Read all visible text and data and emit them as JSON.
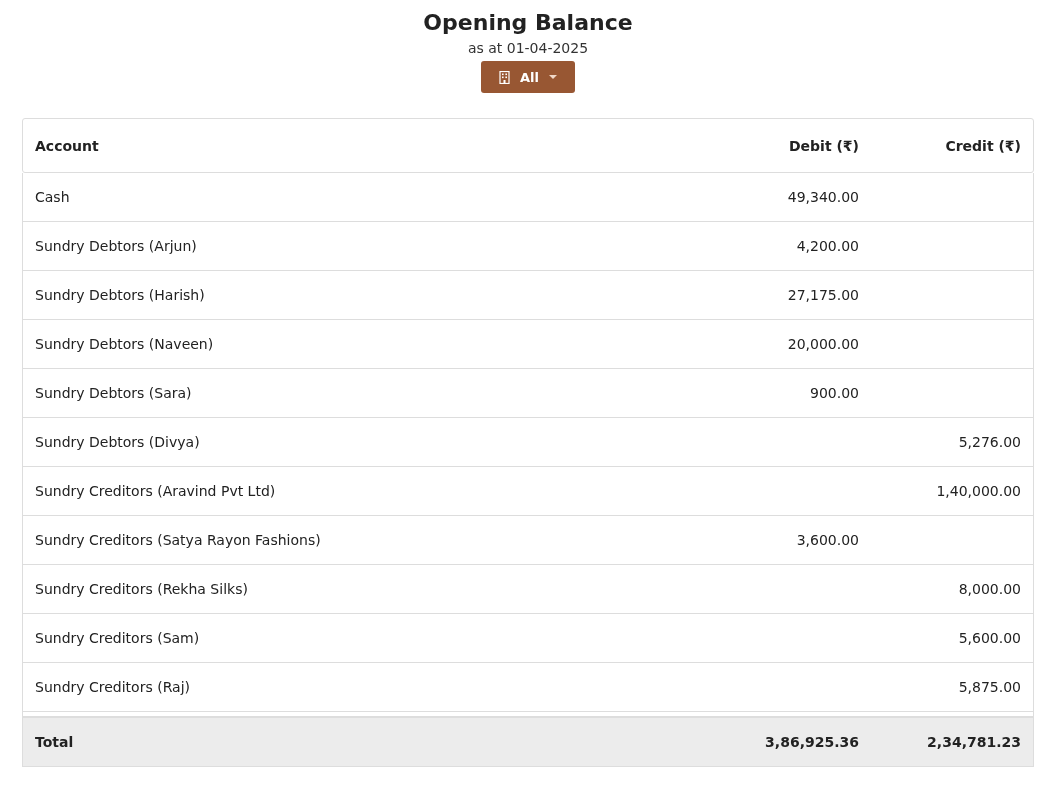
{
  "title": "Opening Balance",
  "subtitle": "as at 01-04-2025",
  "branch_button": {
    "label": "All"
  },
  "table": {
    "columns": [
      "Account",
      "Debit (₹)",
      "Credit (₹)"
    ],
    "rows": [
      {
        "account": "Cash",
        "debit": "49,340.00",
        "credit": ""
      },
      {
        "account": "Sundry Debtors (Arjun)",
        "debit": "4,200.00",
        "credit": ""
      },
      {
        "account": "Sundry Debtors (Harish)",
        "debit": "27,175.00",
        "credit": ""
      },
      {
        "account": "Sundry Debtors (Naveen)",
        "debit": "20,000.00",
        "credit": ""
      },
      {
        "account": "Sundry Debtors (Sara)",
        "debit": "900.00",
        "credit": ""
      },
      {
        "account": "Sundry Debtors (Divya)",
        "debit": "",
        "credit": "5,276.00"
      },
      {
        "account": "Sundry Creditors (Aravind Pvt Ltd)",
        "debit": "",
        "credit": "1,40,000.00"
      },
      {
        "account": "Sundry Creditors (Satya Rayon Fashions)",
        "debit": "3,600.00",
        "credit": ""
      },
      {
        "account": "Sundry Creditors (Rekha Silks)",
        "debit": "",
        "credit": "8,000.00"
      },
      {
        "account": "Sundry Creditors (Sam)",
        "debit": "",
        "credit": "5,600.00"
      },
      {
        "account": "Sundry Creditors (Raj)",
        "debit": "",
        "credit": "5,875.00"
      }
    ],
    "total": {
      "label": "Total",
      "debit": "3,86,925.36",
      "credit": "2,34,781.23"
    }
  }
}
